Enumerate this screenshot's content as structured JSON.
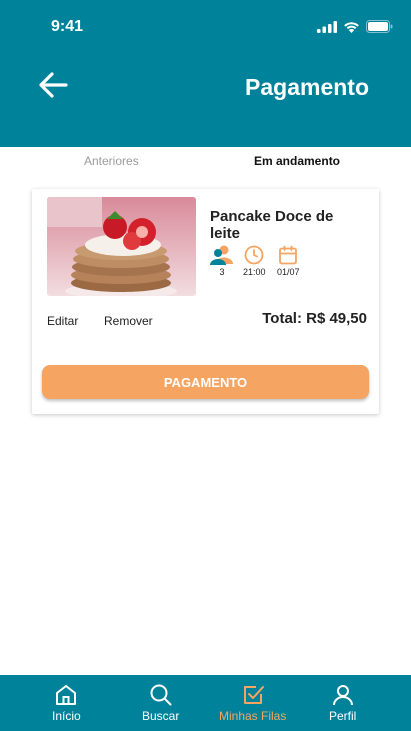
{
  "status_bar": {
    "time": "9:41"
  },
  "header": {
    "title": "Pagamento"
  },
  "tabs": [
    {
      "label": "Anteriores"
    },
    {
      "label": "Em andamento"
    }
  ],
  "order": {
    "name": "Pancake Doce de leite",
    "people": "3",
    "time": "21:00",
    "date": "01/07",
    "edit_label": "Editar",
    "remove_label": "Remover",
    "total": "Total: R$ 49,50",
    "pay_label": "PAGAMENTO"
  },
  "nav": [
    {
      "label": "Início",
      "icon": "home-icon"
    },
    {
      "label": "Buscar",
      "icon": "search-icon"
    },
    {
      "label": "Minhas Filas",
      "icon": "checkbox-icon"
    },
    {
      "label": "Perfil",
      "icon": "user-icon"
    }
  ],
  "colors": {
    "primary": "#00839A",
    "accent": "#F5A462"
  }
}
